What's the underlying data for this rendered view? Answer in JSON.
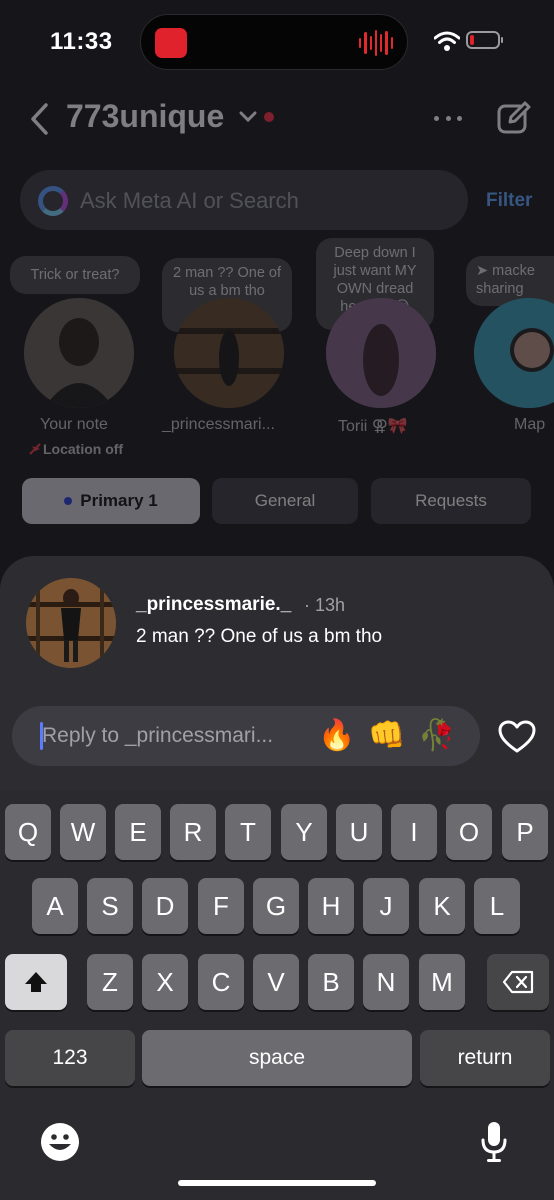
{
  "status_bar": {
    "time": "11:33"
  },
  "header": {
    "account_name": "773unique"
  },
  "search": {
    "placeholder": "Ask Meta AI or Search",
    "filter_label": "Filter"
  },
  "notes": [
    {
      "bubble": "Trick or treat?",
      "label": "Your note",
      "sublabel": "Location off"
    },
    {
      "bubble": "2 man ?? One of us a bm tho",
      "label": "_princessmari..."
    },
    {
      "bubble": "Deep down I just want MY OWN dread head 💯😌",
      "label": "Torii ⚢🎀"
    },
    {
      "bubble": "➤ macke sharing",
      "label": "Map"
    }
  ],
  "tabs": [
    {
      "label": "Primary 1"
    },
    {
      "label": "General"
    },
    {
      "label": "Requests"
    }
  ],
  "reply_sheet": {
    "username": "_princessmarie._",
    "time": "· 13h",
    "message": "2 man ?? One of us a bm tho",
    "input_placeholder": "Reply to _princessmari...",
    "quick_reactions": [
      "🔥",
      "👊",
      "🥀"
    ]
  },
  "keyboard": {
    "row1": [
      "Q",
      "W",
      "E",
      "R",
      "T",
      "Y",
      "U",
      "I",
      "O",
      "P"
    ],
    "row2": [
      "A",
      "S",
      "D",
      "F",
      "G",
      "H",
      "J",
      "K",
      "L"
    ],
    "row3": [
      "Z",
      "X",
      "C",
      "V",
      "B",
      "N",
      "M"
    ],
    "numbers_key": "123",
    "space_key": "space",
    "return_key": "return"
  },
  "colors": {
    "accent_blue": "#5ea3ff",
    "recording_red": "#e0222c",
    "unread_dot": "#ff2a45",
    "sheet_bg": "#2c2c31"
  }
}
